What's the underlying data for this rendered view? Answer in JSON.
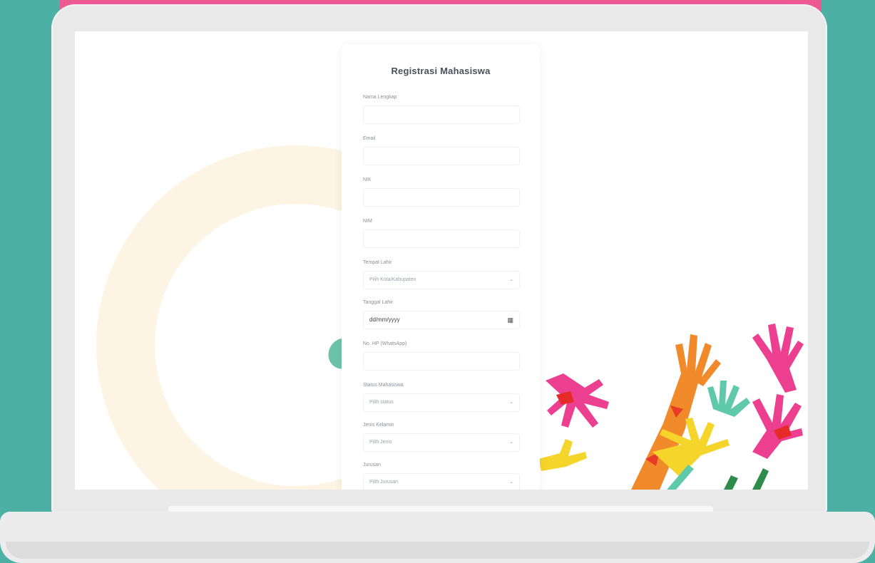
{
  "form": {
    "title": "Registrasi Mahasiswa",
    "fields": [
      {
        "label": "Nama Lengkap",
        "value": "",
        "type": "text"
      },
      {
        "label": "Email",
        "value": "",
        "type": "text"
      },
      {
        "label": "NIK",
        "value": "",
        "type": "text"
      },
      {
        "label": "NIM",
        "value": "",
        "type": "text"
      },
      {
        "label": "Tempat Lahir",
        "value": "Pilih Kota/Kabupaten",
        "type": "select"
      },
      {
        "label": "Tanggal Lahir",
        "value": "dd/mm/yyyy",
        "type": "date"
      },
      {
        "label": "No. HP (WhatsApp)",
        "value": "",
        "type": "text"
      },
      {
        "label": "Status Mahasiswa",
        "value": "Pilih status",
        "type": "select"
      },
      {
        "label": "Jenis Kelamin",
        "value": "Pilih Jenis",
        "type": "select"
      },
      {
        "label": "Jurusan",
        "value": "Pilih Jurusan",
        "type": "select"
      }
    ]
  },
  "colors": {
    "background": "#4db0a4",
    "accent_strip": "#ec5a91",
    "ring": "#fdf4e3"
  },
  "icons": {
    "select": "chevron-down-icon",
    "date": "calendar-icon"
  }
}
